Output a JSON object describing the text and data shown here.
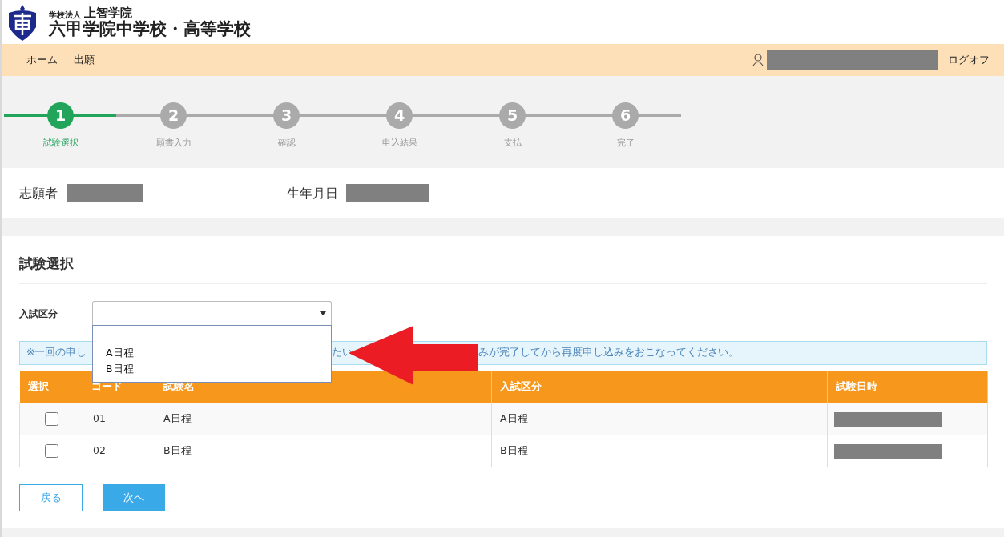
{
  "header": {
    "corporation_prefix": "学校法人",
    "corporation": "上智学院",
    "school": "六甲学院中学校・高等学校"
  },
  "nav": {
    "items": [
      {
        "label": "ホーム"
      },
      {
        "label": "出願"
      }
    ],
    "logout": "ログオフ"
  },
  "steps": [
    {
      "number": "1",
      "label": "試験選択",
      "selected": true
    },
    {
      "number": "2",
      "label": "願書入力",
      "selected": false
    },
    {
      "number": "3",
      "label": "確認",
      "selected": false
    },
    {
      "number": "4",
      "label": "申込結果",
      "selected": false
    },
    {
      "number": "5",
      "label": "支払",
      "selected": false
    },
    {
      "number": "6",
      "label": "完了",
      "selected": false
    }
  ],
  "applicant": {
    "name_label": "志願者",
    "birth_label": "生年月日"
  },
  "section_title": "試験選択",
  "exam_type": {
    "label": "入試区分",
    "expanded": true,
    "options": [
      {
        "label": "A日程"
      },
      {
        "label": "B日程"
      }
    ]
  },
  "notice_fragments": [
    "※一回の申し",
    "たい",
    "みが完了してから再度申し込みをおこなってください。"
  ],
  "table": {
    "columns": [
      "選択",
      "コード",
      "試験名",
      "入試区分",
      "試験日時"
    ],
    "rows": [
      {
        "checked": false,
        "code": "01",
        "name": "A日程",
        "type": "A日程"
      },
      {
        "checked": false,
        "code": "02",
        "name": "B日程",
        "type": "B日程"
      }
    ]
  },
  "buttons": {
    "back": "戻る",
    "next": "次へ"
  }
}
